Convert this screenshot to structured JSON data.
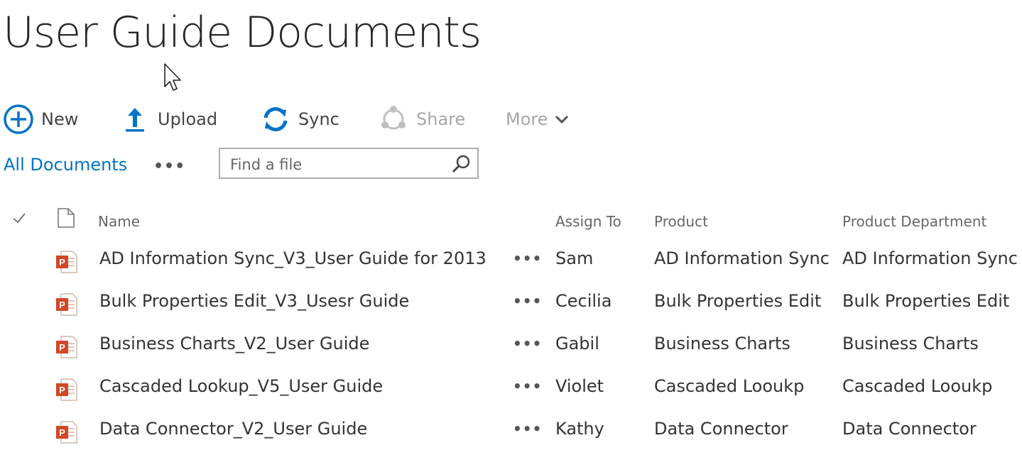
{
  "page": {
    "title": "User Guide Documents"
  },
  "toolbar": {
    "new_label": "New",
    "upload_label": "Upload",
    "sync_label": "Sync",
    "share_label": "Share",
    "more_label": "More",
    "icons": [
      "plus-circle-icon",
      "upload-arrow-icon",
      "sync-icon",
      "share-icon",
      "chevron-down-icon"
    ],
    "accent_color": "#0072c6",
    "disabled_color": "#a6a6a6"
  },
  "views": {
    "current_view": "All Documents",
    "more_views": "•••"
  },
  "search": {
    "placeholder": "Find a file",
    "value": ""
  },
  "table": {
    "columns": {
      "name": "Name",
      "assign_to": "Assign To",
      "product": "Product",
      "product_department": "Product Department"
    },
    "row_menu": "•••",
    "rows": [
      {
        "name": "AD Information Sync_V3_User Guide for 2013",
        "assign_to": "Sam",
        "product": "AD Information Sync",
        "product_department": "AD Information Sync",
        "file_type_icon": "powerpoint-file-icon"
      },
      {
        "name": "Bulk Properties Edit_V3_Usesr Guide",
        "assign_to": "Cecilia",
        "product": "Bulk Properties Edit",
        "product_department": "Bulk Properties Edit",
        "file_type_icon": "powerpoint-file-icon"
      },
      {
        "name": "Business Charts_V2_User Guide",
        "assign_to": "Gabil",
        "product": "Business Charts",
        "product_department": "Business Charts",
        "file_type_icon": "powerpoint-file-icon"
      },
      {
        "name": "Cascaded Lookup_V5_User Guide",
        "assign_to": "Violet",
        "product": "Cascaded Looukp",
        "product_department": "Cascaded Looukp",
        "file_type_icon": "powerpoint-file-icon"
      },
      {
        "name": "Data Connector_V2_User Guide",
        "assign_to": "Kathy",
        "product": "Data Connector",
        "product_department": "Data Connector",
        "file_type_icon": "powerpoint-file-icon"
      }
    ]
  }
}
